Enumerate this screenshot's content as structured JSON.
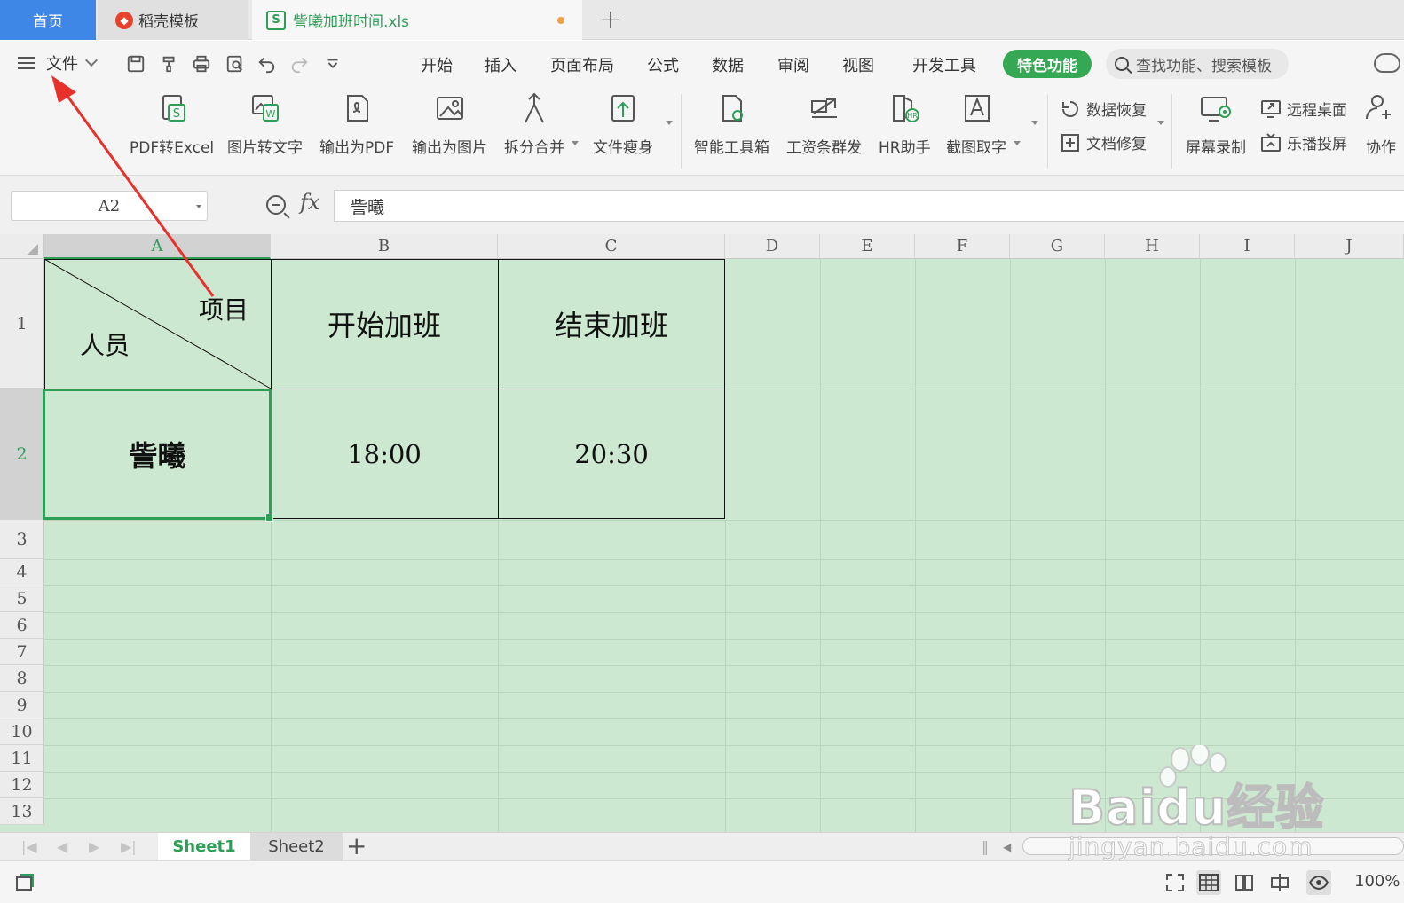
{
  "tabs": {
    "home": "首页",
    "template": "稻壳模板",
    "document": "訾曦加班时间.xls"
  },
  "menu": {
    "file": "文件",
    "items": [
      "开始",
      "插入",
      "页面布局",
      "公式",
      "数据",
      "审阅",
      "视图",
      "开发工具"
    ],
    "special": "特色功能",
    "search_placeholder": "查找功能、搜索模板"
  },
  "ribbon": {
    "tools": [
      "PDF转Excel",
      "图片转文字",
      "输出为PDF",
      "输出为图片",
      "拆分合并",
      "文件瘦身",
      "智能工具箱",
      "工资条群发",
      "HR助手",
      "截图取字"
    ],
    "small_tools": [
      "数据恢复",
      "文档修复",
      "远程桌面",
      "乐播投屏"
    ],
    "screen_record": "屏幕录制",
    "collab": "协作"
  },
  "formula_bar": {
    "cell_ref": "A2",
    "fx": "fx",
    "content": "訾曦"
  },
  "grid": {
    "columns": [
      "A",
      "B",
      "C",
      "D",
      "E",
      "F",
      "G",
      "H",
      "I",
      "J"
    ],
    "rows": [
      "1",
      "2",
      "3",
      "4",
      "5",
      "6",
      "7",
      "8",
      "9",
      "10",
      "11",
      "12",
      "13"
    ],
    "header_diag_top": "项目",
    "header_diag_bottom": "人员",
    "header_b": "开始加班",
    "header_c": "结束加班",
    "name": "訾曦",
    "start_time": "18:00",
    "end_time": "20:30"
  },
  "sheets": [
    "Sheet1",
    "Sheet2"
  ],
  "status": {
    "zoom": "100%"
  },
  "watermark": {
    "line1": "Baidu经验",
    "line2": "jingyan.baidu.com"
  },
  "colors": {
    "accent_green": "#2e9e57",
    "home_tab_blue": "#3f87e6",
    "grid_bg": "#cde8d0",
    "annotation_red": "#e8312a"
  }
}
